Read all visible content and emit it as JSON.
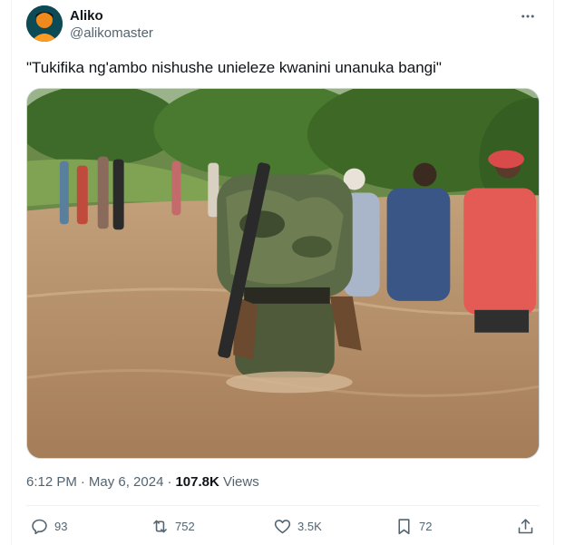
{
  "author": {
    "name": "Aliko",
    "handle": "@alikomaster"
  },
  "tweet": {
    "text": "\"Tukifika ng'ambo nishushe unieleze kwanini unanuka bangi\""
  },
  "meta": {
    "time": "6:12 PM",
    "date": "May 6, 2024",
    "views_count": "107.8K",
    "views_label": "Views"
  },
  "actions": {
    "replies": "93",
    "reposts": "752",
    "likes": "3.5K",
    "bookmarks": "72"
  },
  "icons": {
    "more": "more-horizontal-icon",
    "reply": "reply-icon",
    "repost": "repost-icon",
    "like": "heart-icon",
    "bookmark": "bookmark-icon",
    "share": "share-icon"
  },
  "colors": {
    "text": "#0f1419",
    "secondary": "#536471",
    "divider": "#eff3f4",
    "water": "#b68f6a"
  }
}
